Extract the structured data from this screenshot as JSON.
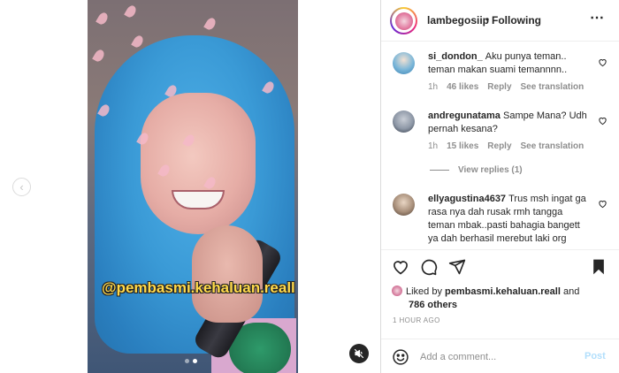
{
  "post": {
    "watermark": "@pembasmi.kehaluan.reall",
    "carousel_dots": 2,
    "active_dot": 1
  },
  "header": {
    "username": "lambegosiip",
    "separator": "•",
    "follow_status": "Following",
    "more_icon": "⋯"
  },
  "comments": [
    {
      "username": "si_dondon_",
      "text": "Aku punya teman.. teman makan suami temannnn..",
      "time": "1h",
      "likes": "46 likes",
      "reply": "Reply",
      "translate": "See translation"
    },
    {
      "username": "andregunatama",
      "text": "Sampe Mana? Udh pernah kesana?",
      "time": "1h",
      "likes": "15 likes",
      "reply": "Reply",
      "translate": "See translation",
      "view_replies": "View replies (1)"
    },
    {
      "username": "ellyagustina4637",
      "text": "Trus msh ingat ga rasa nya dah rusak rmh tangga teman mbak..pasti bahagia bangett ya dah berhasil merebut laki org"
    }
  ],
  "likes": {
    "prefix": "Liked by",
    "user": "pembasmi.kehaluan.reall",
    "and": "and",
    "others": "786 others"
  },
  "timestamp": "1 HOUR AGO",
  "add_comment": {
    "placeholder": "Add a comment...",
    "post_label": "Post"
  },
  "colors": {
    "post_button_disabled": "#b2dffc",
    "meta_gray": "#8e8e8e",
    "watermark_yellow": "#ffd94a"
  }
}
